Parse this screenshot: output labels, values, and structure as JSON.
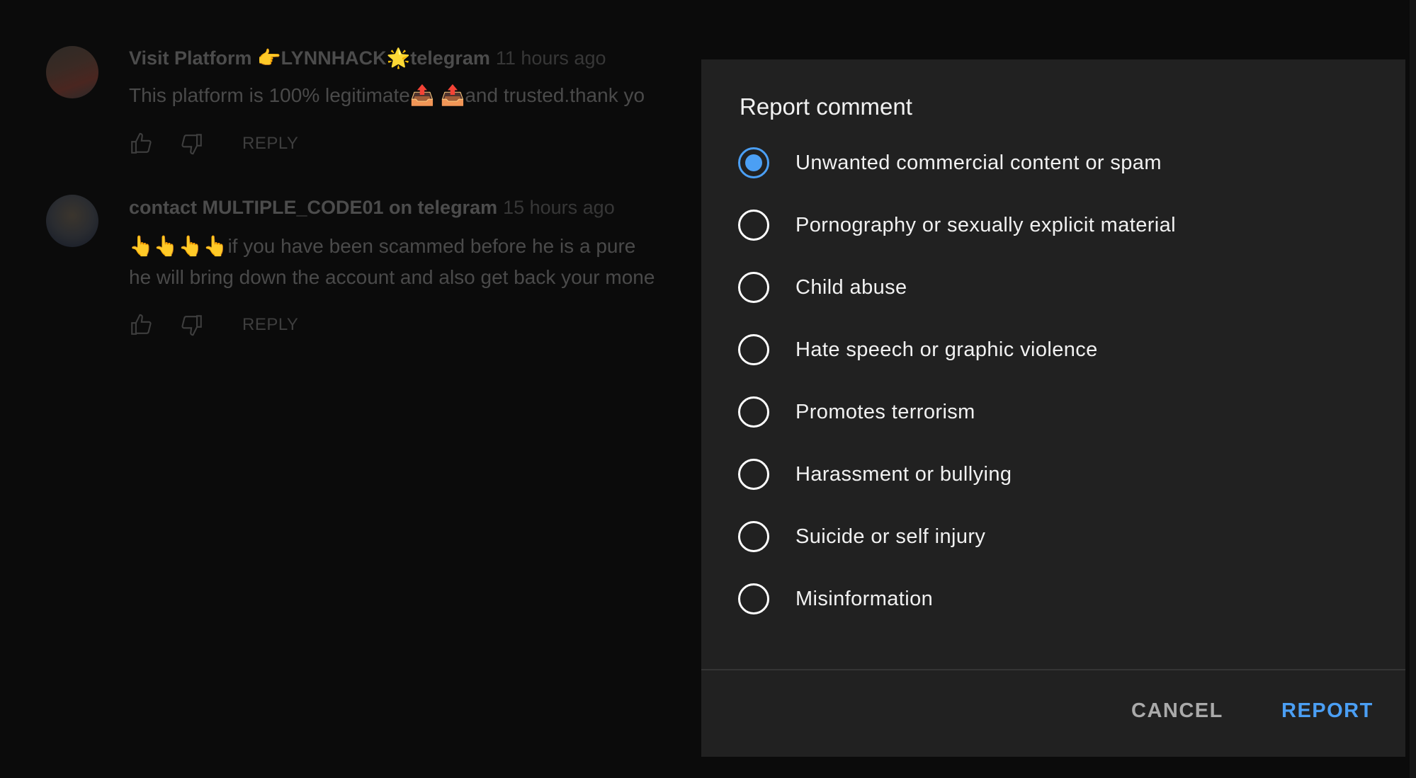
{
  "comments": [
    {
      "author": "Visit Platform 👉LYNNHACK🌟telegram",
      "time": "11 hours ago",
      "lines": [
        "This platform is 100% legitimate📤 📤and trusted.thank yo"
      ],
      "reply": "REPLY"
    },
    {
      "author": "contact MULTIPLE_CODE01 on telegram",
      "time": "15 hours ago",
      "lines": [
        "👆👆👆👆if you have been scammed before he is a pure",
        "he will bring down the account and also get back your mone"
      ],
      "reply": "REPLY"
    }
  ],
  "dialog": {
    "title": "Report comment",
    "options": [
      {
        "label": "Unwanted commercial content or spam",
        "selected": true
      },
      {
        "label": "Pornography or sexually explicit material",
        "selected": false
      },
      {
        "label": "Child abuse",
        "selected": false
      },
      {
        "label": "Hate speech or graphic violence",
        "selected": false
      },
      {
        "label": "Promotes terrorism",
        "selected": false
      },
      {
        "label": "Harassment or bullying",
        "selected": false
      },
      {
        "label": "Suicide or self injury",
        "selected": false
      },
      {
        "label": "Misinformation",
        "selected": false
      }
    ],
    "cancel": "CANCEL",
    "report": "REPORT",
    "accent": "#4b9ff4"
  }
}
